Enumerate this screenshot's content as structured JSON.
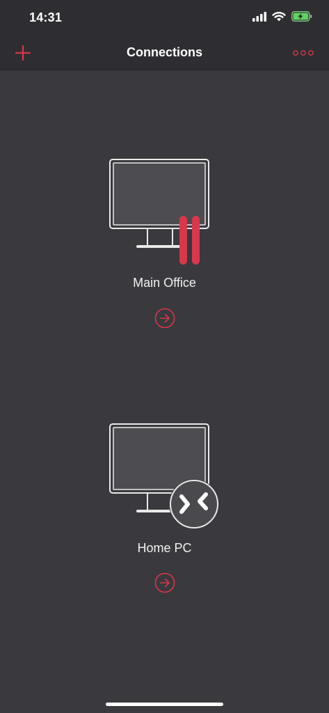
{
  "status_bar": {
    "time": "14:31",
    "icons": [
      "cellular-signal-icon",
      "wifi-icon",
      "battery-charging-icon"
    ]
  },
  "nav": {
    "title": "Connections",
    "add_icon": "plus-icon",
    "more_icon": "more-options-icon"
  },
  "connections": [
    {
      "name": "Main Office",
      "icon": "monitor-paused-icon",
      "action_icon": "arrow-right-circle-icon"
    },
    {
      "name": "Home PC",
      "icon": "monitor-remote-desktop-icon",
      "action_icon": "arrow-right-circle-icon"
    }
  ],
  "colors": {
    "accent": "#d8384a",
    "background": "#3a393d",
    "bar_background": "#2e2d31",
    "battery": "#5ed35e"
  }
}
